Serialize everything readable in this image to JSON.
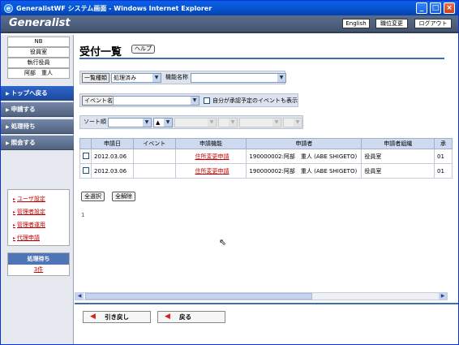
{
  "window": {
    "title": "GeneralistWF システム画面 - Windows Internet Explorer",
    "controls": [
      "_",
      "□",
      "×"
    ]
  },
  "app": {
    "logo": "Generalist",
    "header_buttons": [
      "English",
      "職位変更",
      "ログアウト"
    ]
  },
  "sidebar": {
    "user_info": [
      "NB",
      "役員室",
      "執行役員",
      "阿部　重人"
    ],
    "nav": [
      {
        "label": "トップへ戻る",
        "active": true
      },
      {
        "label": "申請する",
        "active": false
      },
      {
        "label": "処理待ち",
        "active": false
      },
      {
        "label": "照会する",
        "active": false
      }
    ],
    "links": [
      "ユーザ設定",
      "管理者設定",
      "管理者運用",
      "代理申請"
    ],
    "pending": {
      "label": "処理待ち",
      "count": "3件"
    }
  },
  "main": {
    "title": "受付一覧",
    "help": "ヘルプ",
    "filters": {
      "list_type_label": "一覧種類",
      "list_type_value": "処理済み",
      "function_label": "機能名称",
      "function_value": "",
      "event_label": "イベント名",
      "event_value": "",
      "self_approve_label": "自分が承認予定のイベントも表示",
      "sort_label": "ソート順",
      "sort_dir1": "▲"
    },
    "table": {
      "headers": [
        "",
        "申請日",
        "イベント",
        "申請機能",
        "申請者",
        "申請者組織",
        "承"
      ],
      "rows": [
        [
          "",
          "2012.03.06",
          "",
          "住所変更申請",
          "190000002:阿部　重人 (ABE SHIGETO)",
          "役員室",
          "01"
        ],
        [
          "",
          "2012.03.06",
          "",
          "住所変更申請",
          "190000002:阿部　重人 (ABE SHIGETO)",
          "役員室",
          "01"
        ]
      ]
    },
    "select_all": "全選択",
    "deselect_all": "全解除",
    "page": "1",
    "actions": {
      "pull_back": "引き戻し",
      "back": "戻る"
    }
  }
}
